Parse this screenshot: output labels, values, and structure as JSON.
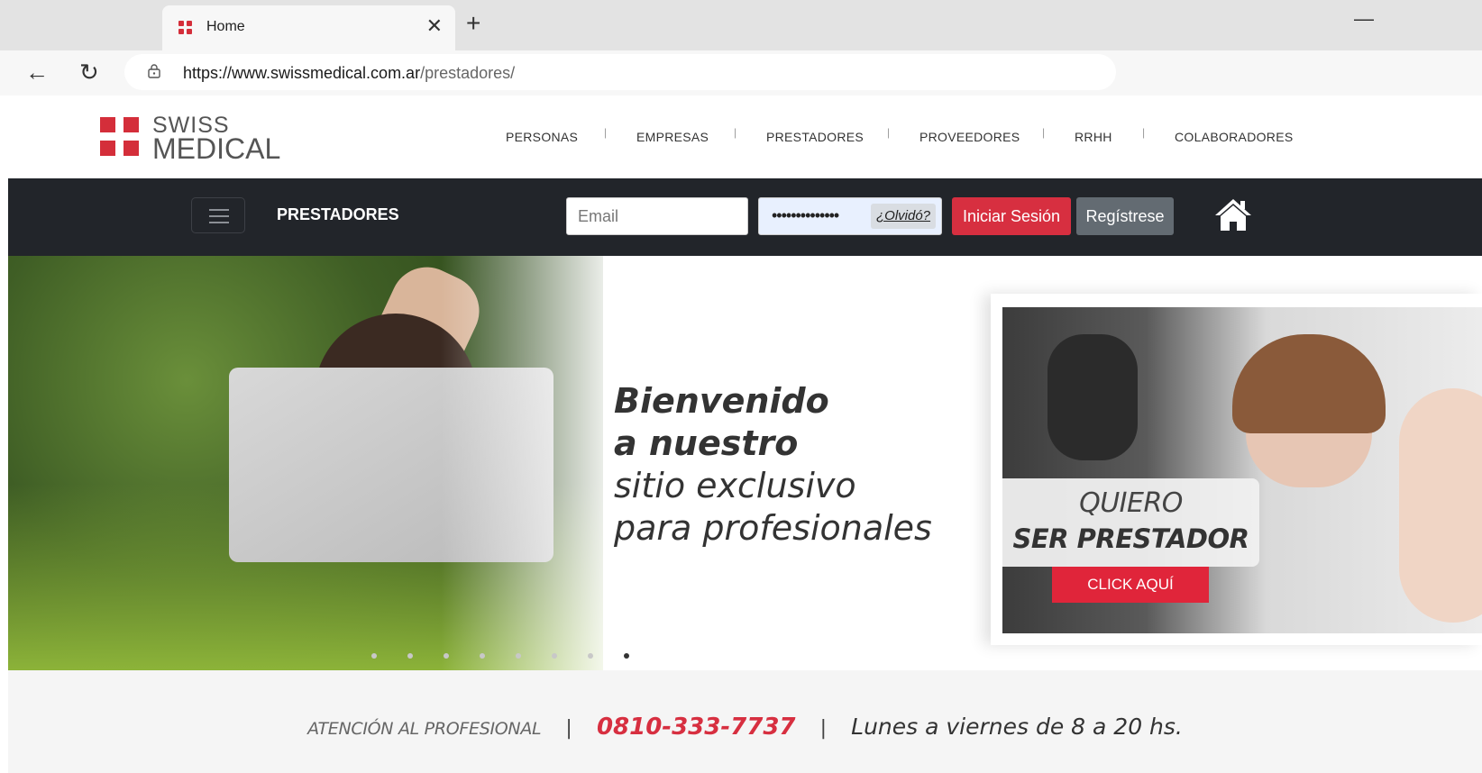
{
  "browser": {
    "tab_title": "Home",
    "url_domain": "https://www.swissmedical.com.ar",
    "url_path": "/prestadores/"
  },
  "logo": {
    "line1": "SWISS",
    "line2": "MEDICAL"
  },
  "top_nav": [
    "PERSONAS",
    "EMPRESAS",
    "PRESTADORES",
    "PROVEEDORES",
    "RRHH",
    "COLABORADORES"
  ],
  "login_bar": {
    "section_title": "PRESTADORES",
    "email_placeholder": "Email",
    "password_dots": "••••••••••••••",
    "forgot_label": "¿Olvidó?",
    "login_button": "Iniciar Sesión",
    "register_button": "Regístrese"
  },
  "hero": {
    "line1": "Bienvenido",
    "line2": "a nuestro",
    "line3": "sitio exclusivo",
    "line4": "para profesionales",
    "slides_total": 8,
    "slide_active": 8
  },
  "promo": {
    "line1": "QUIERO",
    "line2": "SER PRESTADOR",
    "button": "CLICK AQUÍ"
  },
  "footer": {
    "label": "ATENCIÓN AL PROFESIONAL",
    "phone": "0810-333-7737",
    "hours": "Lunes a viernes de 8 a 20 hs."
  },
  "colors": {
    "brand_red": "#d42e3a",
    "dark_bar": "#22252a",
    "login_button": "#d72f40",
    "register_button": "#636b72"
  }
}
